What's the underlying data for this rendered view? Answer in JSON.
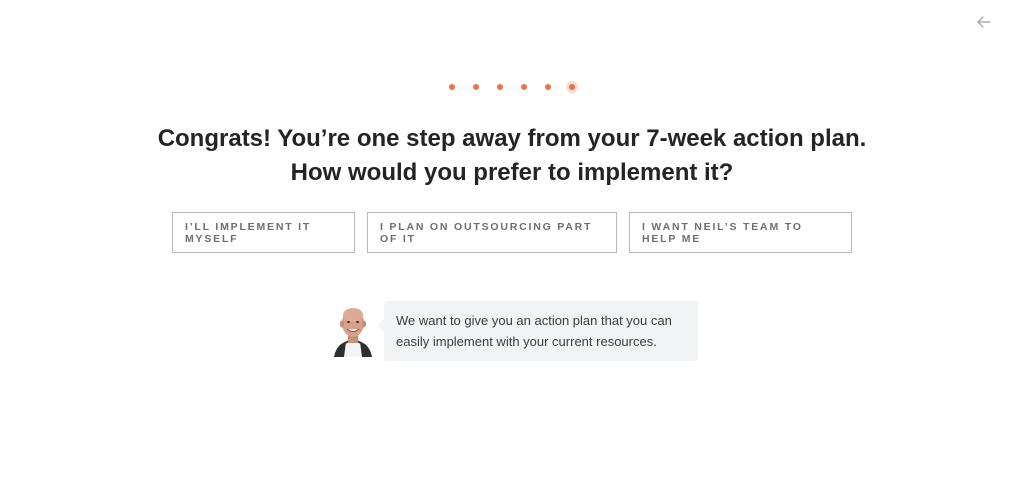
{
  "header": {
    "back_icon": "arrow-left-icon"
  },
  "progress": {
    "total_steps": 6,
    "current_step": 6,
    "accent_color": "#e8734a"
  },
  "question": {
    "line1": "Congrats! You’re one step away from your 7-week action plan.",
    "line2": "How would you prefer to implement it?"
  },
  "options": [
    {
      "label": "I’ll implement it myself"
    },
    {
      "label": "I plan on outsourcing part of it"
    },
    {
      "label": "I want Neil’s team to help me"
    }
  ],
  "advisor": {
    "avatar_icon": "avatar",
    "message": "We want to give you an action plan that you can easily implement with your current resources."
  }
}
